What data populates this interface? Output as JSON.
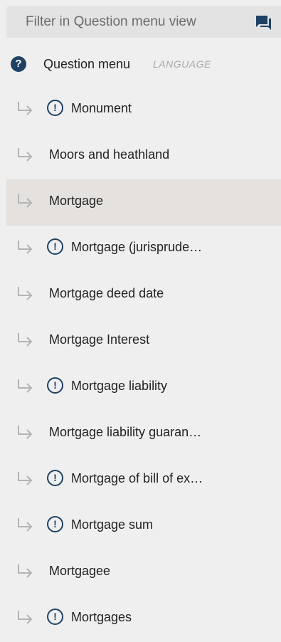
{
  "filter": {
    "placeholder": "Filter in Question menu view",
    "icon": "chat-bubbles-icon"
  },
  "root": {
    "icon": "question-circle-icon",
    "label": "Question menu",
    "tag": "LANGUAGE"
  },
  "items": [
    {
      "label": "Monument",
      "warning": true,
      "selected": false
    },
    {
      "label": "Moors and heathland",
      "warning": false,
      "selected": false
    },
    {
      "label": "Mortgage",
      "warning": false,
      "selected": true
    },
    {
      "label": "Mortgage (jurisprude…",
      "warning": true,
      "selected": false
    },
    {
      "label": "Mortgage deed date",
      "warning": false,
      "selected": false
    },
    {
      "label": "Mortgage Interest",
      "warning": false,
      "selected": false
    },
    {
      "label": "Mortgage liability",
      "warning": true,
      "selected": false
    },
    {
      "label": "Mortgage liability guaran…",
      "warning": false,
      "selected": false
    },
    {
      "label": "Mortgage of bill of ex…",
      "warning": true,
      "selected": false
    },
    {
      "label": "Mortgage sum",
      "warning": true,
      "selected": false
    },
    {
      "label": "Mortgagee",
      "warning": false,
      "selected": false
    },
    {
      "label": "Mortgages",
      "warning": true,
      "selected": false
    }
  ],
  "colors": {
    "background": "#efefef",
    "selected_row": "#e4e1de",
    "accent": "#1f4264",
    "arrow": "#b4b4b4"
  },
  "icons": {
    "child_arrow": "child-arrow-icon",
    "warning": "exclamation-circle-icon"
  }
}
